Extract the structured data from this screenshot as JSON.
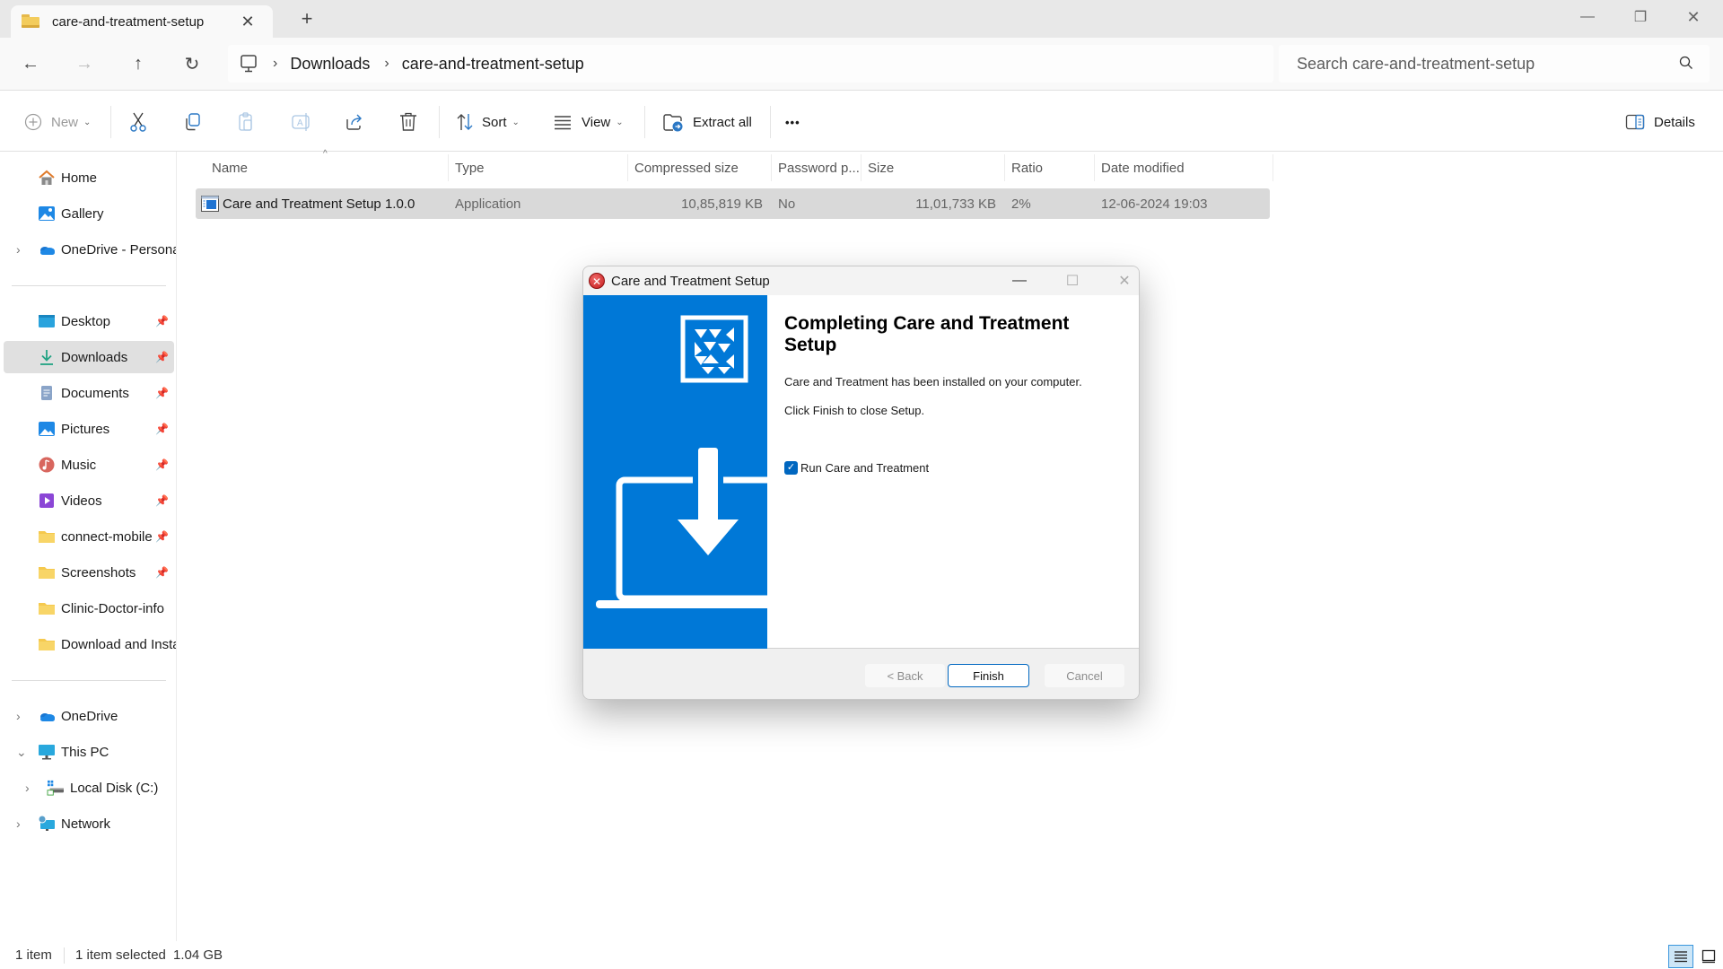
{
  "window": {
    "tab_title": "care-and-treatment-setup",
    "new_tab_label": "+",
    "controls": {
      "minimize": "—",
      "restore": "❐",
      "close": "✕"
    }
  },
  "nav": {
    "back_icon": "←",
    "forward_icon": "→",
    "up_icon": "↑",
    "refresh_icon": "↻",
    "breadcrumb": [
      "Downloads",
      "care-and-treatment-setup"
    ],
    "breadcrumb_sep": "›",
    "search_placeholder": "Search care-and-treatment-setup"
  },
  "toolbar": {
    "new_label": "New",
    "sort_label": "Sort",
    "view_label": "View",
    "extract_label": "Extract all",
    "more_label": "•••",
    "details_label": "Details",
    "caret": "⌄"
  },
  "sidebar": {
    "top": [
      {
        "label": "Home",
        "icon": "home-icon"
      },
      {
        "label": "Gallery",
        "icon": "gallery-icon"
      },
      {
        "label": "OneDrive - Personal",
        "icon": "onedrive-icon",
        "expandable": true
      }
    ],
    "quick_access": [
      {
        "label": "Desktop",
        "icon": "desktop-icon",
        "pinned": true
      },
      {
        "label": "Downloads",
        "icon": "downloads-icon",
        "pinned": true,
        "selected": true
      },
      {
        "label": "Documents",
        "icon": "documents-icon",
        "pinned": true
      },
      {
        "label": "Pictures",
        "icon": "pictures-icon",
        "pinned": true
      },
      {
        "label": "Music",
        "icon": "music-icon",
        "pinned": true
      },
      {
        "label": "Videos",
        "icon": "videos-icon",
        "pinned": true
      },
      {
        "label": "connect-mobile",
        "icon": "folder-icon",
        "pinned": true
      },
      {
        "label": "Screenshots",
        "icon": "folder-icon",
        "pinned": true
      },
      {
        "label": "Clinic-Doctor-info",
        "icon": "folder-icon",
        "pinned": false
      },
      {
        "label": "Download and Install",
        "icon": "folder-icon",
        "pinned": false
      }
    ],
    "bottom": [
      {
        "label": "OneDrive",
        "icon": "onedrive-icon",
        "chevron": "›"
      },
      {
        "label": "This PC",
        "icon": "pc-icon",
        "chevron": "⌄"
      },
      {
        "label": "Local Disk (C:)",
        "icon": "disk-icon",
        "chevron": "›"
      },
      {
        "label": "Network",
        "icon": "network-icon",
        "chevron": "›"
      }
    ],
    "pin_glyph": "📌"
  },
  "filelist": {
    "columns": [
      "Name",
      "Type",
      "Compressed size",
      "Password p...",
      "Size",
      "Ratio",
      "Date modified"
    ],
    "sort_indicator": "^",
    "rows": [
      {
        "name": "Care and Treatment Setup 1.0.0",
        "type": "Application",
        "compressed_size": "10,85,819 KB",
        "password": "No",
        "size": "11,01,733 KB",
        "ratio": "2%",
        "date_modified": "12-06-2024 19:03",
        "selected": true
      }
    ]
  },
  "status": {
    "count": "1 item",
    "selection": "1 item selected",
    "selection_size": "1.04 GB"
  },
  "dialog": {
    "title": "Care and Treatment Setup",
    "heading": "Completing Care and Treatment Setup",
    "line1": "Care and Treatment has been installed on your computer.",
    "line2": "Click Finish to close Setup.",
    "checkbox_label": "Run Care and Treatment",
    "checkbox_checked": true,
    "back_label": "< Back",
    "finish_label": "Finish",
    "cancel_label": "Cancel",
    "accent_color": "#0078D7",
    "controls": {
      "minimize": "—",
      "maximize": "☐",
      "close": "✕"
    }
  }
}
